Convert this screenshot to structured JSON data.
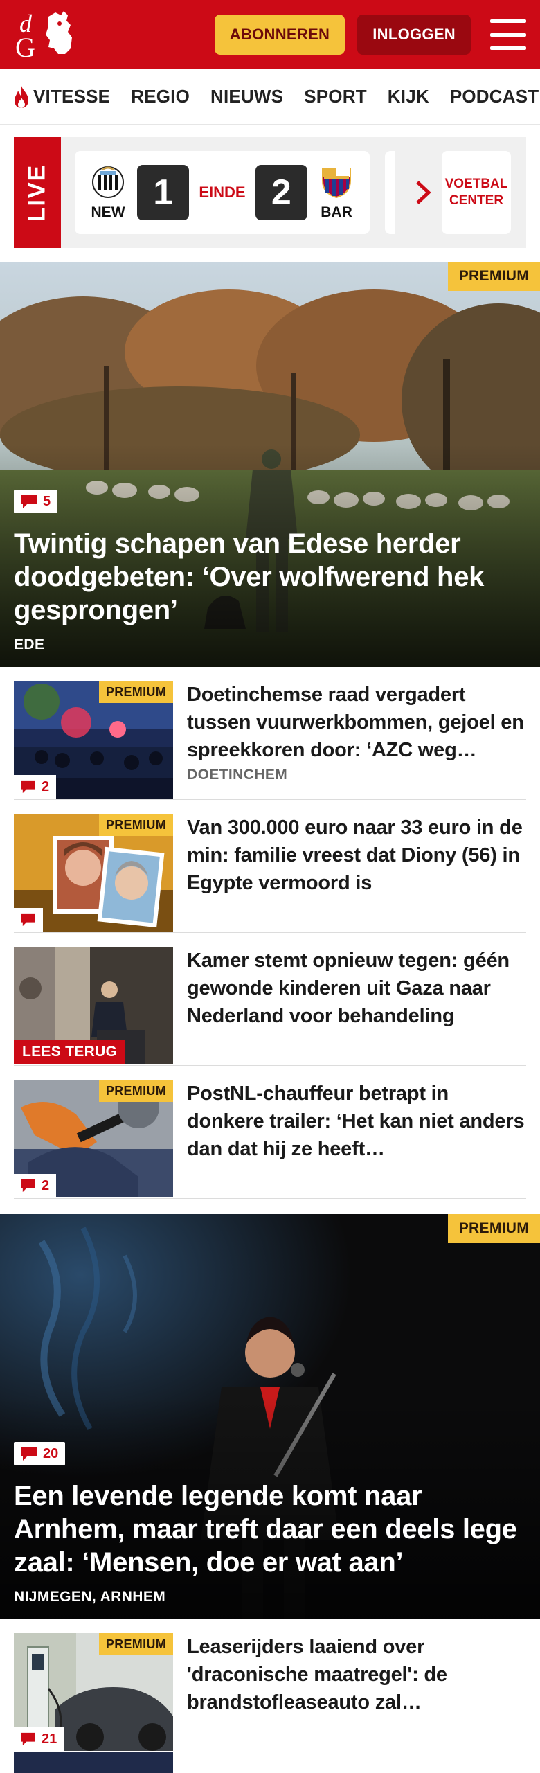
{
  "header": {
    "subscribe_label": "ABONNEREN",
    "login_label": "INLOGGEN",
    "brand_color": "#cc0a16",
    "accent_color": "#f5c33b"
  },
  "nav": {
    "items": [
      {
        "label": "VITESSE",
        "icon": "flame-icon"
      },
      {
        "label": "REGIO"
      },
      {
        "label": "NIEUWS"
      },
      {
        "label": "SPORT"
      },
      {
        "label": "KIJK"
      },
      {
        "label": "PODCAST"
      }
    ]
  },
  "live": {
    "tag": "LIVE",
    "match": {
      "home": "NEW",
      "home_score": "1",
      "status": "EINDE",
      "away_score": "2",
      "away": "BAR"
    },
    "center_label_1": "VOETBAL",
    "center_label_2": "CENTER"
  },
  "hero": {
    "premium": "PREMIUM",
    "comments": "5",
    "title": "Twintig schapen van Edese herder doodgebeten: ‘Over wolfwerend hek gesprongen’",
    "location": "EDE"
  },
  "articles": [
    {
      "premium": "PREMIUM",
      "comments": "2",
      "title": "Doetinchemse raad vergadert tussen vuurwerkbommen, gejoel en spreekkoren door: ‘AZC weg…",
      "location": "DOETINCHEM"
    },
    {
      "premium": "PREMIUM",
      "comments": "",
      "title": "Van 300.000 euro naar 33 euro in de min: familie vreest dat Diony (56) in Egypte vermoord is",
      "location": ""
    },
    {
      "lees_terug": "LEES TERUG",
      "title": "Kamer stemt opnieuw tegen: géén gewonde kinderen uit Gaza naar Nederland voor behandeling",
      "location": ""
    },
    {
      "premium": "PREMIUM",
      "comments": "2",
      "title": "PostNL-chauffeur betrapt in donkere trailer: ‘Het kan niet anders dan dat hij ze heeft…",
      "location": ""
    }
  ],
  "hero2": {
    "premium": "PREMIUM",
    "comments": "20",
    "title": "Een levende legende komt naar Arnhem, maar treft daar een deels lege zaal: ‘Mensen, doe er wat aan’",
    "location": "NIJMEGEN, ARNHEM"
  },
  "articles2": [
    {
      "premium": "PREMIUM",
      "comments": "21",
      "title": "Leaserijders laaiend over 'draconische maatregel': de brandstofleaseauto zal…"
    }
  ]
}
